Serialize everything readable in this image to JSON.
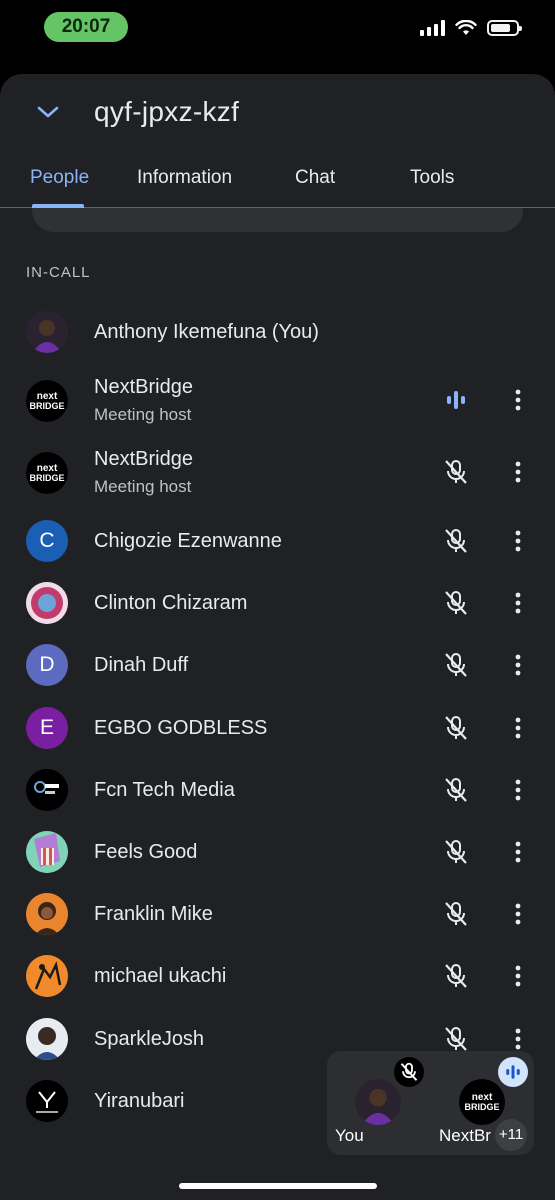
{
  "status_bar": {
    "time": "20:07",
    "icons": [
      "signal-icon",
      "wifi-icon",
      "battery-icon"
    ]
  },
  "header": {
    "meeting_code": "qyf-jpxz-kzf",
    "collapse_icon": "chevron-down-icon"
  },
  "tabs": [
    {
      "label": "People",
      "active": true
    },
    {
      "label": "Information",
      "active": false
    },
    {
      "label": "Chat",
      "active": false
    },
    {
      "label": "Tools",
      "active": false
    }
  ],
  "section_label": "IN-CALL",
  "participants": [
    {
      "name": "Anthony Ikemefuna (You)",
      "subtitle": "",
      "avatar": "photo",
      "mic": "none"
    },
    {
      "name": "NextBridge",
      "subtitle": "Meeting host",
      "avatar": "nextbridge-logo",
      "mic": "speaking"
    },
    {
      "name": "NextBridge",
      "subtitle": "Meeting host",
      "avatar": "nextbridge-logo",
      "mic": "muted"
    },
    {
      "name": "Chigozie Ezenwanne",
      "subtitle": "",
      "avatar": "initial",
      "initial": "C",
      "avatar_color": "#1a5fb4",
      "mic": "muted"
    },
    {
      "name": "Clinton Chizaram",
      "subtitle": "",
      "avatar": "photo",
      "mic": "muted"
    },
    {
      "name": "Dinah Duff",
      "subtitle": "",
      "avatar": "initial",
      "initial": "D",
      "avatar_color": "#5c6bc0",
      "mic": "muted"
    },
    {
      "name": "EGBO GODBLESS",
      "subtitle": "",
      "avatar": "initial",
      "initial": "E",
      "avatar_color": "#7b1fa2",
      "mic": "muted"
    },
    {
      "name": "Fcn Tech Media",
      "subtitle": "",
      "avatar": "photo",
      "mic": "muted"
    },
    {
      "name": "Feels Good",
      "subtitle": "",
      "avatar": "photo",
      "mic": "muted"
    },
    {
      "name": "Franklin Mike",
      "subtitle": "",
      "avatar": "photo",
      "mic": "muted"
    },
    {
      "name": "michael ukachi",
      "subtitle": "",
      "avatar": "photo",
      "mic": "muted"
    },
    {
      "name": "SparkleJosh",
      "subtitle": "",
      "avatar": "photo",
      "mic": "muted"
    },
    {
      "name": "Yiranubari",
      "subtitle": "",
      "avatar": "photo",
      "mic": "hidden"
    }
  ],
  "pip": {
    "you_label": "You",
    "nextbridge_label": "NextBr",
    "extra_count": "+11"
  },
  "colors": {
    "accent": "#8ab4f8",
    "sheet_bg": "#202124",
    "speaking": "#8ab4f8"
  }
}
